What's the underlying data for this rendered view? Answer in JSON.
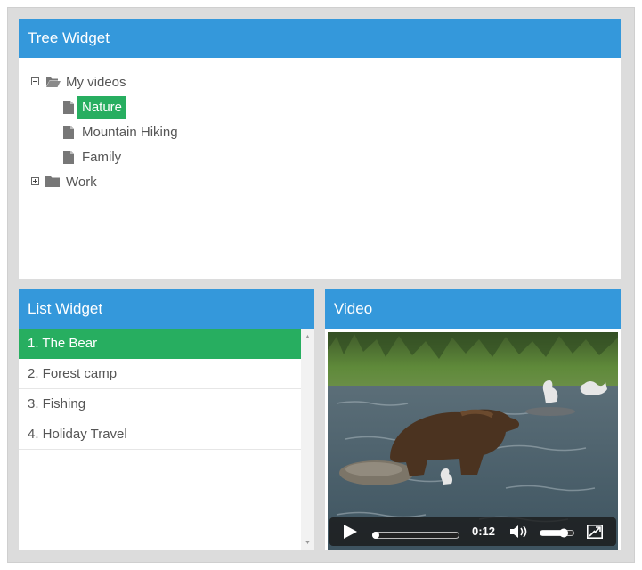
{
  "tree_widget": {
    "title": "Tree Widget",
    "nodes": [
      {
        "label": "My videos",
        "expanded": true,
        "icon": "folder-open-icon"
      },
      {
        "label": "Nature",
        "selected": true,
        "icon": "file-icon"
      },
      {
        "label": "Mountain Hiking",
        "icon": "file-icon"
      },
      {
        "label": "Family",
        "icon": "file-icon"
      },
      {
        "label": "Work",
        "expanded": false,
        "icon": "folder-icon"
      }
    ]
  },
  "list_widget": {
    "title": "List Widget",
    "items": [
      "1. The Bear",
      "2. Forest camp",
      "3. Fishing",
      "4. Holiday Travel"
    ],
    "selected_index": 0
  },
  "video_widget": {
    "title": "Video",
    "current_time": "0:12",
    "progress": 0.04,
    "volume": 0.7
  },
  "colors": {
    "header": "#3498db",
    "selected": "#27ae60",
    "frame": "#dcdcdc"
  }
}
